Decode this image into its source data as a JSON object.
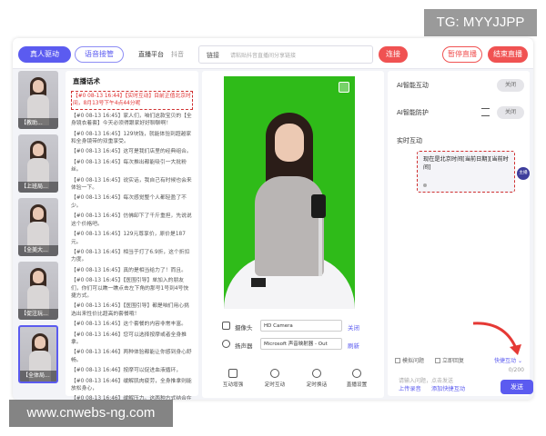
{
  "watermarks": {
    "top_right": "TG: MYYJJPP",
    "bottom_left": "www.cnwebs-ng.com"
  },
  "header": {
    "real_person_button": "真人驱动",
    "voice_button": "语音接管",
    "platform_label": "直播平台",
    "platform_value": "抖音",
    "link_label": "链接",
    "link_placeholder": "请粘贴抖音直播间分享链接",
    "connect_button": "连接",
    "pause_button": "暂停直播",
    "end_button": "结束直播"
  },
  "thumbnails": [
    {
      "caption": "【教助..."
    },
    {
      "caption": "【上班局..."
    },
    {
      "caption": "【全美大..."
    },
    {
      "caption": "【促注玩..."
    },
    {
      "caption": "【全体局..."
    }
  ],
  "script": {
    "title": "直播话术",
    "lines": [
      "【#0 08-13 16:44】【实时互动】目前正值北京时间，8月13号下午4点44分呢",
      "【#0 08-13 16:45】家人们，咱们这款宝贝的【全身镜衣着套】今天必须得跟家好好聊聊啊！",
      "【#0 08-13 16:45】129块钱，就能体验到超越家和全身镜带的双重享受。",
      "【#0 08-13 16:45】这可是我们店里的经典组合。",
      "【#0 08-13 16:45】每次推出都能吸引一大批粉丝。",
      "【#0 08-13 16:45】说实话，我自己有时候也会来体验一下。",
      "【#0 08-13 16:45】每次感觉整个人都轻盈了不少。",
      "【#0 08-13 16:45】仿佛卸下了千斤重担，先说说这个价格吧。",
      "【#0 08-13 16:45】129元尊享价，原价是187元。",
      "【#0 08-13 16:45】相当于打了6.9折，这个折扣力度。",
      "【#0 08-13 16:45】真的是相当给力了！而且。",
      "【#0 08-13 16:45】【医围引导】单加入的朋友们，你们可以瞧一瞧点击左下角的那号1号到4号快捷方式。",
      "【#0 08-13 16:45】【医围引导】都是咱们用心挑选出来性价比超高的套餐哦！",
      "【#0 08-13 16:45】这个套餐的内容非常丰富。",
      "【#0 08-13 16:46】您可以选择按摩或者全身推拿。",
      "【#0 08-13 16:46】两种体验都能让你感到身心舒畅。",
      "【#0 08-13 16:46】按摩可以促进血液循环，",
      "【#0 08-13 16:46】缓解肌肉疲劳，全身推拿则能放松身心，",
      "【#0 08-13 16:46】缓解压力。这两种方式结合在一起。"
    ]
  },
  "devices": {
    "camera_label": "摄像头",
    "camera_value": "HD Camera",
    "camera_action": "关闭",
    "mic_label": "扬声器",
    "mic_value": "Microsoft 声音映射器 - Out",
    "mic_action": "刷新"
  },
  "tools": [
    {
      "label": "互动增强"
    },
    {
      "label": "定时互动"
    },
    {
      "label": "定时换话"
    },
    {
      "label": "直播设置"
    }
  ],
  "ai": {
    "interaction_label": "AI智能互动",
    "interaction_toggle": "关闭",
    "protection_label": "AI智能防护",
    "protection_toggle": "关闭"
  },
  "realtime": {
    "title": "实时互动",
    "message": "现在是北京时间[当前日期][当前时间]",
    "badge": "主播",
    "mock_question": "模拟问题",
    "instant_reply": "立即回复",
    "quick_interact": "快捷互动",
    "input_placeholder": "请输入问题，点击发送",
    "counter": "0/200",
    "upload_recording": "上传录音",
    "add_quick": "添加快捷互动",
    "send_button": "发送"
  },
  "colors": {
    "accent": "#5b5bf0",
    "danger": "#f05252",
    "green_screen": "#2fbb19"
  }
}
